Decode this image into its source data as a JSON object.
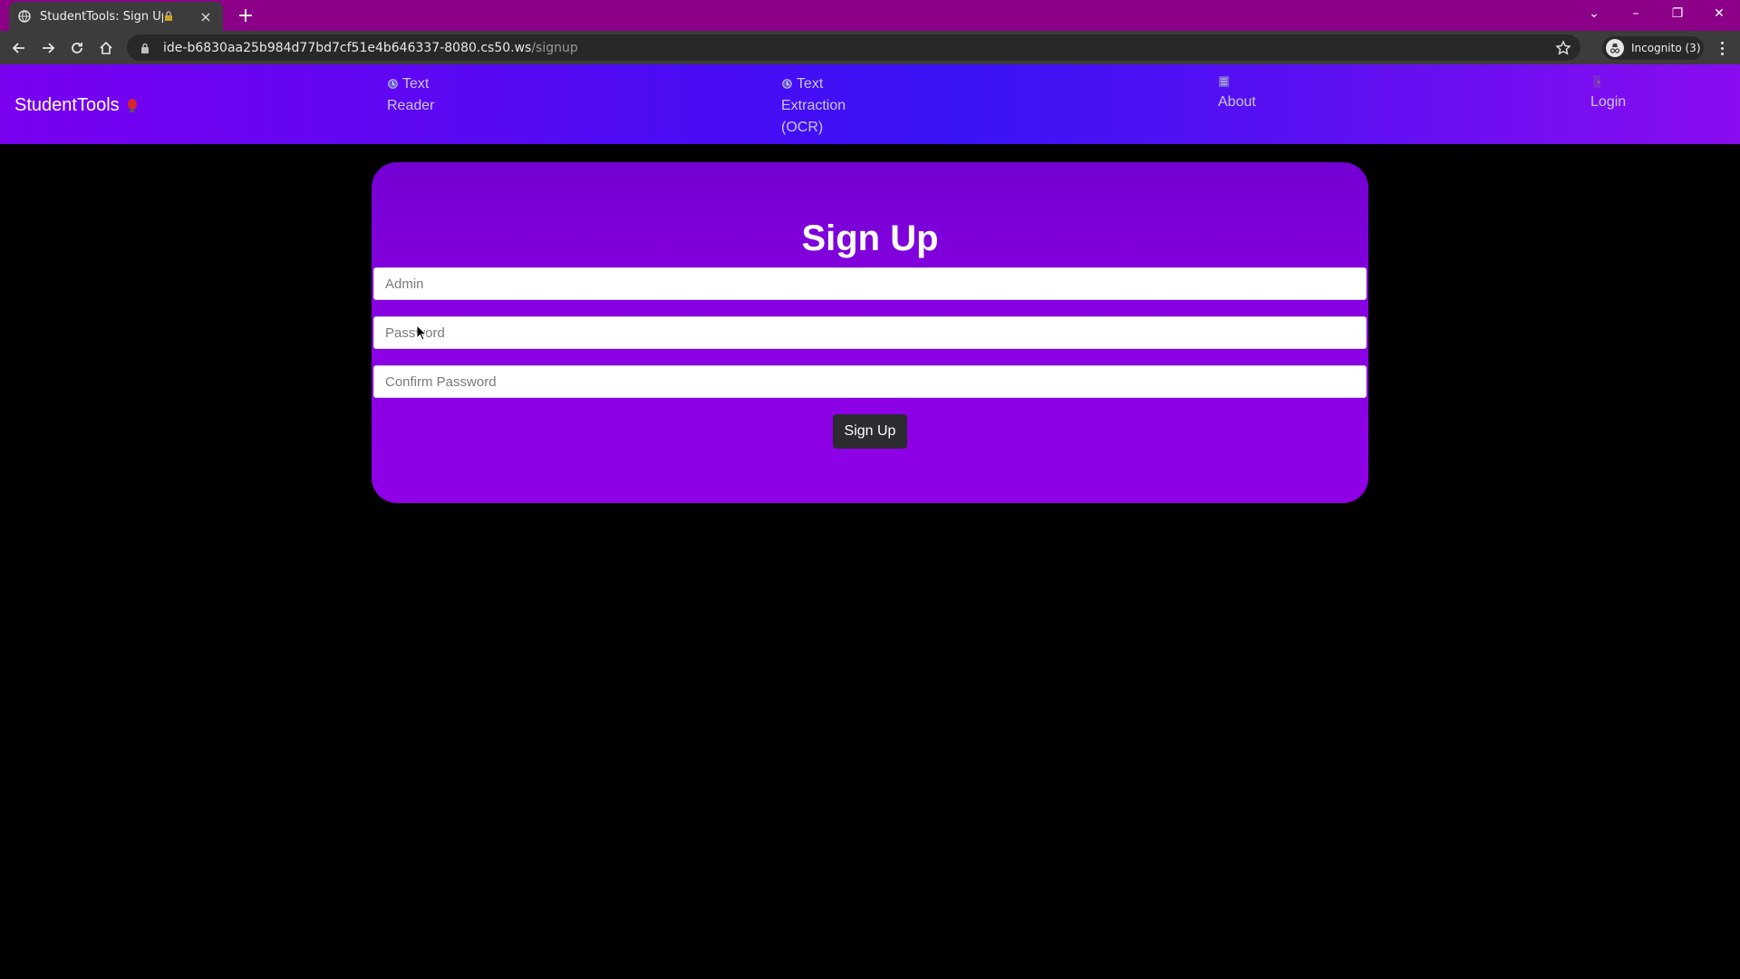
{
  "browser": {
    "tab_title": "StudentTools: Sign Up",
    "url_host": "ide-b6830aa25b984d77bd7cf51e4b646337-8080.cs50.ws",
    "url_path": "/signup",
    "incognito_label": "Incognito (3)"
  },
  "nav": {
    "brand": "StudentTools",
    "links": [
      {
        "label": "Text Reader",
        "icon": "alarm-clock-icon"
      },
      {
        "label": "Text Extraction (OCR)",
        "icon": "alarm-clock-icon"
      },
      {
        "label": "About",
        "icon": "book-icon"
      },
      {
        "label": "Login",
        "icon": "door-icon"
      }
    ]
  },
  "form": {
    "title": "Sign Up",
    "username_placeholder": "Admin",
    "password_placeholder": "Password",
    "confirm_placeholder": "Confirm Password",
    "submit_label": "Sign Up"
  },
  "colors": {
    "tab_strip": "#8b0087",
    "nav_accent": "#4a0cf4",
    "card": "#8a00e4",
    "button": "#2b2b30"
  }
}
